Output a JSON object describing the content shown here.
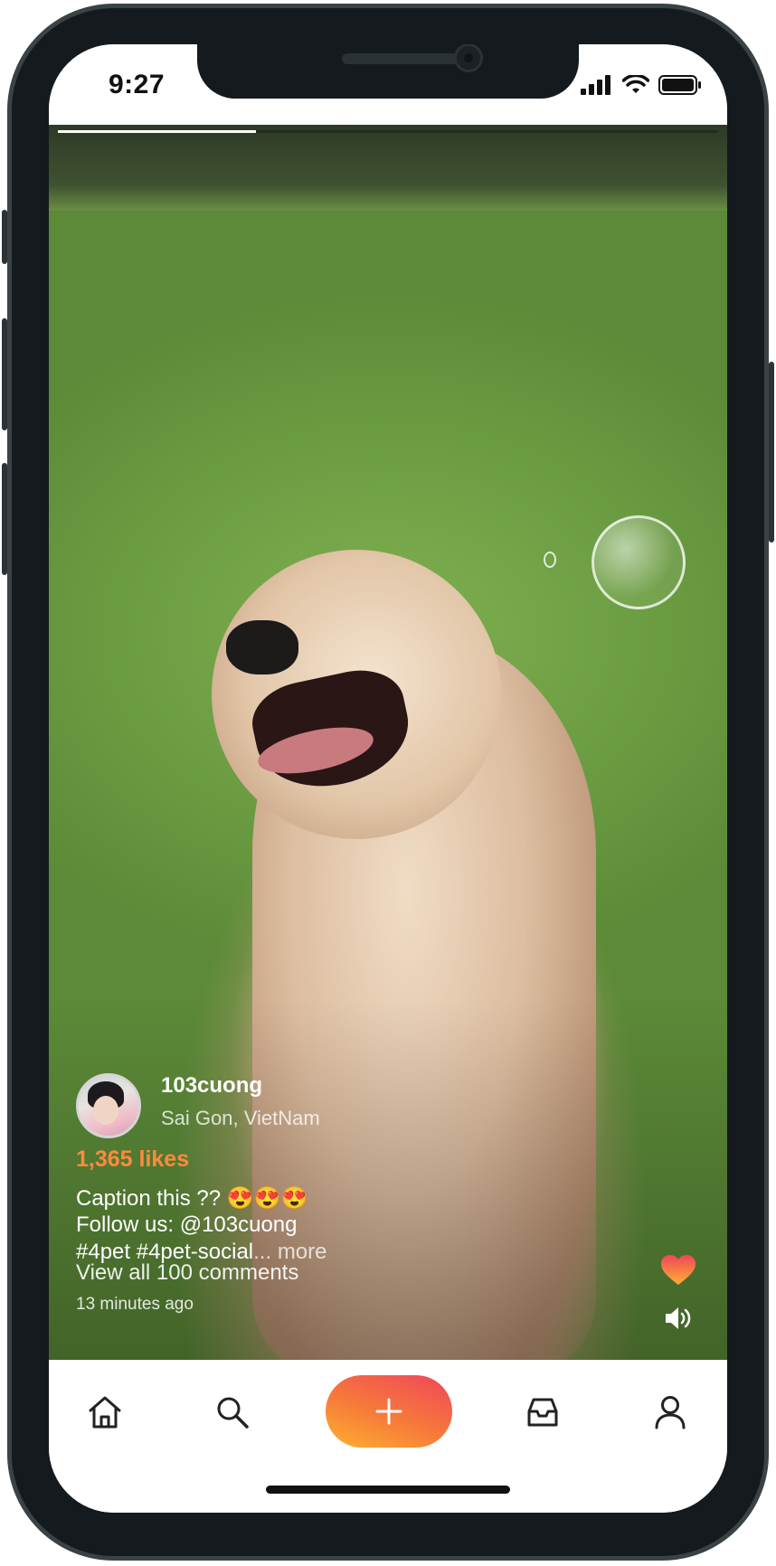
{
  "status_bar": {
    "time": "9:27",
    "icons": [
      "signal-icon",
      "wifi-icon",
      "battery-icon"
    ]
  },
  "story_progress": 0.3,
  "post": {
    "username": "103cuong",
    "location": "Sai Gon, VietNam",
    "likes": "1,365 likes",
    "caption_line1": "Caption this ?? 😍😍😍",
    "caption_line2": "Follow us: @103cuong",
    "caption_line3": "#4pet #4pet-social",
    "more_label": "... more",
    "comments_link": "View all 100 comments",
    "time_ago": "13 minutes ago",
    "liked": true
  },
  "actions": {
    "like_icon": "heart-icon",
    "sound_icon": "speaker-icon"
  },
  "tabbar": {
    "items": [
      "home-icon",
      "search-icon",
      "add-icon",
      "inbox-icon",
      "profile-icon"
    ]
  },
  "colors": {
    "likes_accent": "#ff8a3d",
    "add_gradient_start": "#f0465a",
    "add_gradient_end": "#fdb030",
    "heart_top": "#f0465a",
    "heart_bottom": "#fdb030"
  }
}
